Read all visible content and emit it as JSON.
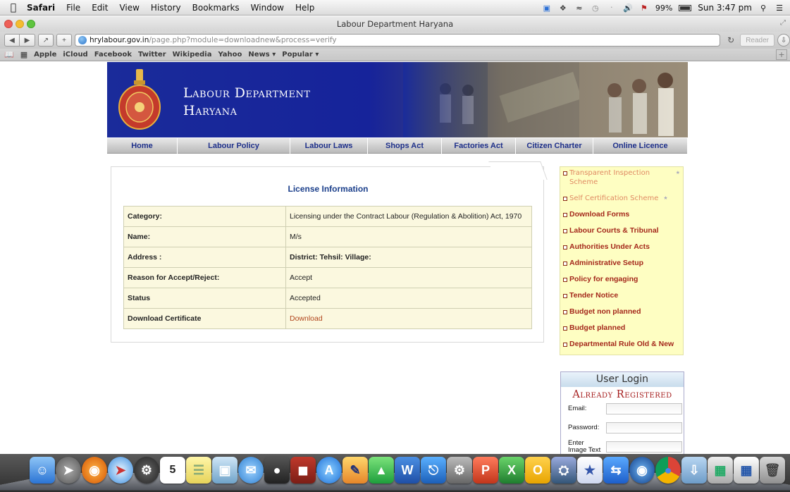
{
  "menubar": {
    "app": "Safari",
    "items": [
      "File",
      "Edit",
      "View",
      "History",
      "Bookmarks",
      "Window",
      "Help"
    ],
    "battery": "99%",
    "clock": "Sun 3:47 pm"
  },
  "window": {
    "title": "Labour Department Haryana"
  },
  "toolbar": {
    "url_domain": "hrylabour.gov.in",
    "url_path": "/page.php?module=downloadnew&process=verify",
    "reader_label": "Reader"
  },
  "bookmarks": [
    "Apple",
    "iCloud",
    "Facebook",
    "Twitter",
    "Wikipedia",
    "Yahoo",
    "News ▾",
    "Popular ▾"
  ],
  "site": {
    "title_line1": "Labour Department",
    "title_line2": "Haryana",
    "nav": [
      "Home",
      "Labour Policy",
      "Labour Laws",
      "Shops Act",
      "Factories Act",
      "Citizen Charter",
      "Online Licence"
    ]
  },
  "license": {
    "heading": "License Information",
    "rows": [
      {
        "label": "Category:",
        "value": "Licensing under the Contract Labour (Regulation & Abolition) Act, 1970"
      },
      {
        "label": "Name:",
        "value": "M/s"
      },
      {
        "label": "Address :",
        "value": "District: Tehsil: Village:"
      },
      {
        "label": "Reason for Accept/Reject:",
        "value": "Accept"
      },
      {
        "label": "Status",
        "value": "Accepted"
      },
      {
        "label": "Download Certificate",
        "value": "Download"
      }
    ]
  },
  "sidebar": {
    "links": [
      "Transparent Inspection Scheme",
      "Self Certification Scheme",
      "Download Forms",
      "Labour Courts & Tribunal",
      "Authorities Under Acts",
      "Administrative Setup",
      "Policy for engaging",
      "Tender Notice",
      "Budget non planned",
      "Budget planned",
      "Departmental Rule Old & New"
    ]
  },
  "login": {
    "heading": "User Login",
    "subheading": "Already Registered",
    "email_label": "Email:",
    "password_label": "Password:",
    "captcha_label_1": "Enter",
    "captcha_label_2": "Image Text"
  },
  "dock": {
    "calendar_day": "5"
  },
  "colors": {
    "banner_blue": "#1a2b9a",
    "nav_text": "#1d2f8a",
    "link_red": "#a4281b",
    "table_bg": "#fbf8df",
    "sidebar_bg": "#fefec2"
  }
}
